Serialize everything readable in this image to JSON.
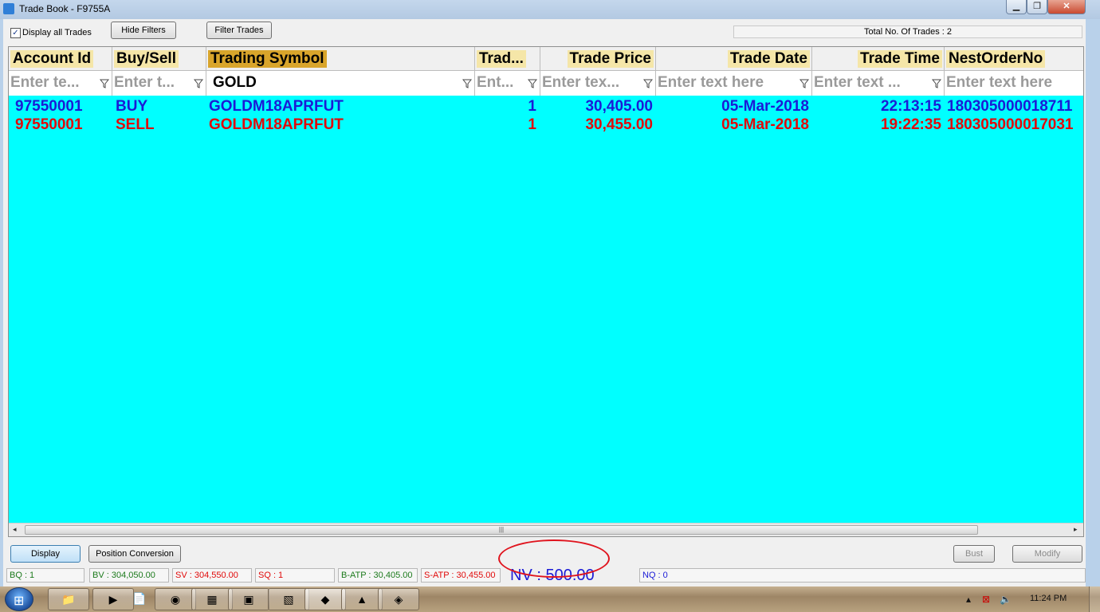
{
  "window": {
    "title": "Trade Book - F9755A",
    "min_label": "▁",
    "max_label": "❐",
    "close_label": "✕"
  },
  "toolbar": {
    "display_all_label": "Display all Trades",
    "display_all_checked": true,
    "hide_filters_label": "Hide Filters",
    "filter_trades_label": "Filter Trades",
    "total_trades": "Total No. Of Trades : 2"
  },
  "grid": {
    "columns": [
      {
        "header": "Account Id",
        "filter_value": "",
        "filter_placeholder": "Enter te..."
      },
      {
        "header": "Buy/Sell",
        "filter_value": "",
        "filter_placeholder": "Enter t..."
      },
      {
        "header": "Trading Symbol",
        "filter_value": "GOLD",
        "filter_placeholder": ""
      },
      {
        "header": "Trad...",
        "filter_value": "",
        "filter_placeholder": "Ent..."
      },
      {
        "header": "Trade Price",
        "filter_value": "",
        "filter_placeholder": "Enter tex..."
      },
      {
        "header": "Trade Date",
        "filter_value": "",
        "filter_placeholder": "Enter text here"
      },
      {
        "header": "Trade Time",
        "filter_value": "",
        "filter_placeholder": "Enter text ..."
      },
      {
        "header": "NestOrderNo",
        "filter_value": "",
        "filter_placeholder": "Enter text here"
      }
    ],
    "rows": [
      {
        "side": "buy",
        "cells": [
          "97550001",
          "BUY",
          "GOLDM18APRFUT",
          "1",
          "30,405.00",
          "05-Mar-2018",
          "22:13:15",
          "180305000018711"
        ]
      },
      {
        "side": "sell",
        "cells": [
          "97550001",
          "SELL",
          "GOLDM18APRFUT",
          "1",
          "30,455.00",
          "05-Mar-2018",
          "19:22:35",
          "180305000017031"
        ]
      }
    ],
    "colors": {
      "background": "#00ffff",
      "buy": "#1b1bd6",
      "sell": "#e10a0a",
      "header_highlight": "#f5e6a8",
      "active_header": "#d9a52b"
    }
  },
  "bottom_buttons": {
    "display_label": "Display",
    "position_conversion_label": "Position Conversion",
    "bust_label": "Bust",
    "modify_label": "Modify"
  },
  "status": {
    "bq": "BQ : 1",
    "bv": "BV : 304,050.00",
    "sv": "SV : 304,550.00",
    "sq": "SQ : 1",
    "batp": "B-ATP : 30,405.00",
    "satp": "S-ATP : 30,455.00",
    "nv": "NV : 500.00",
    "nq": "NQ : 0"
  },
  "taskbar": {
    "clock": "11:24 PM",
    "apps": [
      "folder-icon",
      "media-player-icon",
      "document-icon",
      "chrome-icon",
      "calculator-icon",
      "window-icon",
      "excel-icon",
      "trading-terminal-icon",
      "prism-icon",
      "network-icon"
    ]
  }
}
